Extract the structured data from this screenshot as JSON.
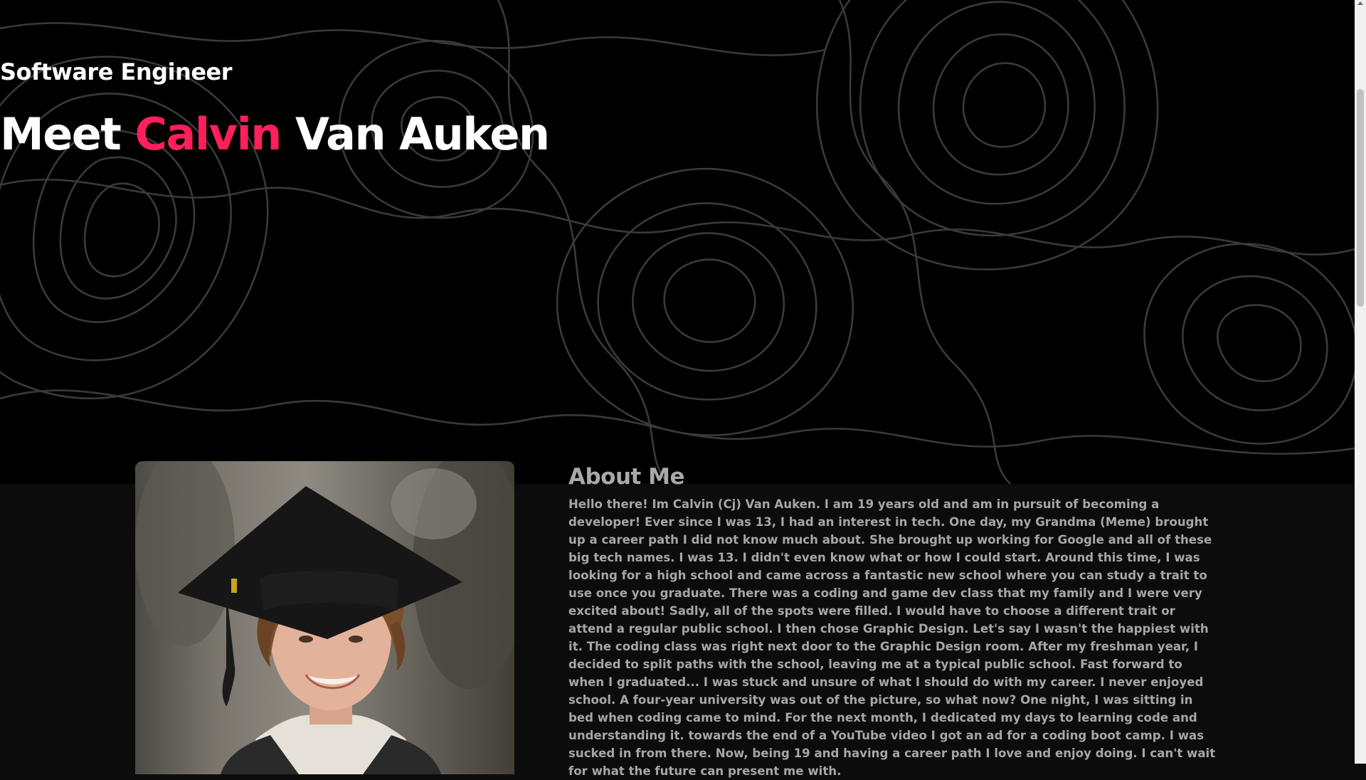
{
  "hero": {
    "subtitle": "Software Engineer",
    "headline_prefix": "Meet",
    "headline_accent": "Calvin",
    "headline_suffix": "Van Auken",
    "accent_color": "#ff1f5a",
    "background_pattern": "topographic-contour-lines"
  },
  "about": {
    "title": "About Me",
    "photo_subject": "portrait in graduation cap",
    "body": "Hello there! Im Calvin (Cj) Van Auken. I am 19 years old and am in pursuit of becoming a developer! Ever since I was 13, I had an interest in tech. One day, my Grandma (Meme) brought up a career path I did not know much about. She brought up working for Google and all of these big tech names. I was 13. I didn't even know what or how I could start. Around this time, I was looking for a high school and came across a fantastic new school where you can study a trait to use once you graduate. There was a coding and game dev class that my family and I were very excited about! Sadly, all of the spots were filled. I would have to choose a different trait or attend a regular public school. I then chose Graphic Design. Let's say I wasn't the happiest with it. The coding class was right next door to the Graphic Design room. After my freshman year, I decided to split paths with the school, leaving me at a typical public school. Fast forward to when I graduated... I was stuck and unsure of what I should do with my career. I never enjoyed school. A four-year university was out of the picture, so what now? One night, I was sitting in bed when coding came to mind. For the next month, I dedicated my days to learning code and understanding it. towards the end of a YouTube video I got an ad for a coding boot camp. I was sucked in from there. Now, being 19 and having a career path I love and enjoy doing. I can't wait for what the future can present me with."
  }
}
